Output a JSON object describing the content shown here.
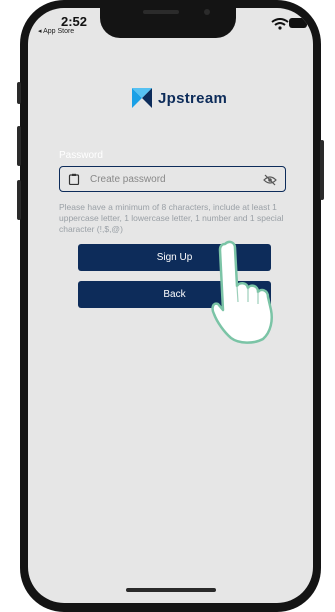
{
  "status_bar": {
    "time": "2:52",
    "back_app": "◂ App Store"
  },
  "logo": {
    "text": "Jpstream"
  },
  "password": {
    "label": "Password",
    "placeholder": "Create password",
    "hint": "Please have a minimum of 8 characters, include at least 1 uppercase letter, 1 lowercase letter, 1 number and 1 special character (!,$,@)"
  },
  "buttons": {
    "sign_up": "Sign Up",
    "back": "Back"
  },
  "colors": {
    "primary": "#0d2c5a",
    "screen_bg": "#e6e6e6",
    "logo_accent": "#1aa0e6"
  },
  "icons": {
    "input_left": "clipboard-icon",
    "input_right": "eye-slash-icon",
    "pointer": "hand-pointer-icon"
  }
}
